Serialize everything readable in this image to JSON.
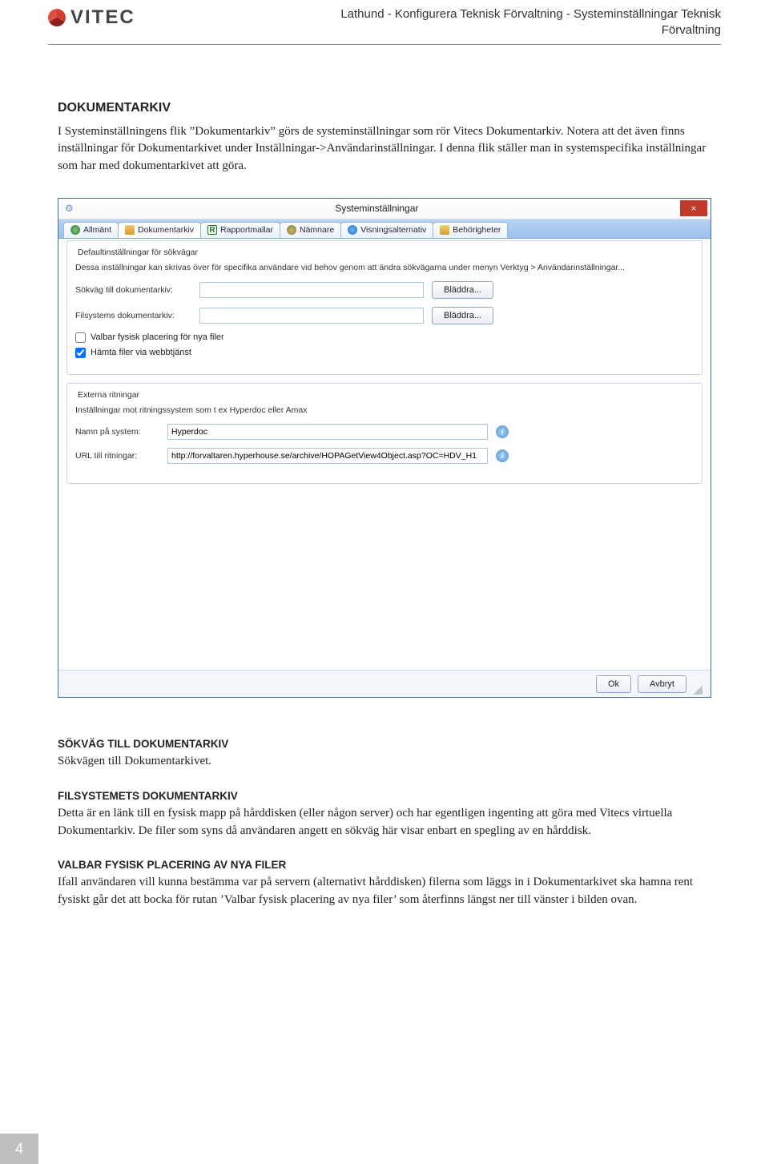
{
  "header": {
    "logo_text": "VITEC",
    "title_line1": "Lathund - Konfigurera Teknisk Förvaltning - Systeminställningar Teknisk",
    "title_line2": "Förvaltning"
  },
  "sec1": {
    "heading": "DOKUMENTARKIV",
    "p1": "I Systeminställningens flik ”Dokumentarkiv” görs de systeminställningar som rör Vitecs Dokumentarkiv. Notera att det även finns inställningar för Dokumentarkivet under Inställningar->Användarinställningar. I denna flik ställer man in systemspecifika inställningar som har med dokumentarkivet att göra."
  },
  "dialog": {
    "title": "Systeminställningar",
    "tabs": [
      "Allmänt",
      "Dokumentarkiv",
      "Rapportmallar",
      "Nämnare",
      "Visningsalternativ",
      "Behörigheter"
    ],
    "fs1": {
      "legend": "Defaultinställningar för sökvägar",
      "desc": "Dessa inställningar kan skrivas över för specifika användare vid behov genom att ändra sökvägarna under menyn Verktyg > Användarinställningar...",
      "row1_label": "Sökväg till dokumentarkiv:",
      "row1_value": "",
      "row2_label": "Filsystems dokumentarkiv:",
      "row2_value": "",
      "browse": "Bläddra...",
      "chk1": "Valbar fysisk placering för nya filer",
      "chk2": "Hämta filer via webbtjänst"
    },
    "fs2": {
      "legend": "Externa ritningar",
      "desc": "Inställningar mot ritningssystem som t ex Hyperdoc eller Amax",
      "row1_label": "Namn på system:",
      "row1_value": "Hyperdoc",
      "row2_label": "URL till ritningar:",
      "row2_value": "http://forvaltaren.hyperhouse.se/archive/HOPAGetView4Object.asp?OC=HDV_H1"
    },
    "ok": "Ok",
    "cancel": "Avbryt"
  },
  "sec2": {
    "heading": "SÖKVÄG TILL DOKUMENTARKIV",
    "p1": "Sökvägen till Dokumentarkivet."
  },
  "sec3": {
    "heading": "FILSYSTEMETS DOKUMENTARKIV",
    "p1": "Detta är en länk till en fysisk mapp på hårddisken (eller någon server) och har egentligen ingenting att göra med Vitecs virtuella Dokumentarkiv. De filer som syns då användaren angett en sökväg här visar enbart en spegling av en hårddisk."
  },
  "sec4": {
    "heading": "VALBAR FYSISK PLACERING AV NYA FILER",
    "p1": "Ifall användaren vill kunna bestämma var på servern (alternativt hårddisken) filerna som läggs in i Dokumentarkivet ska hamna rent fysiskt går det att bocka för rutan ’Valbar fysisk placering av nya filer’ som återfinns längst ner till vänster i bilden ovan."
  },
  "page_number": "4"
}
